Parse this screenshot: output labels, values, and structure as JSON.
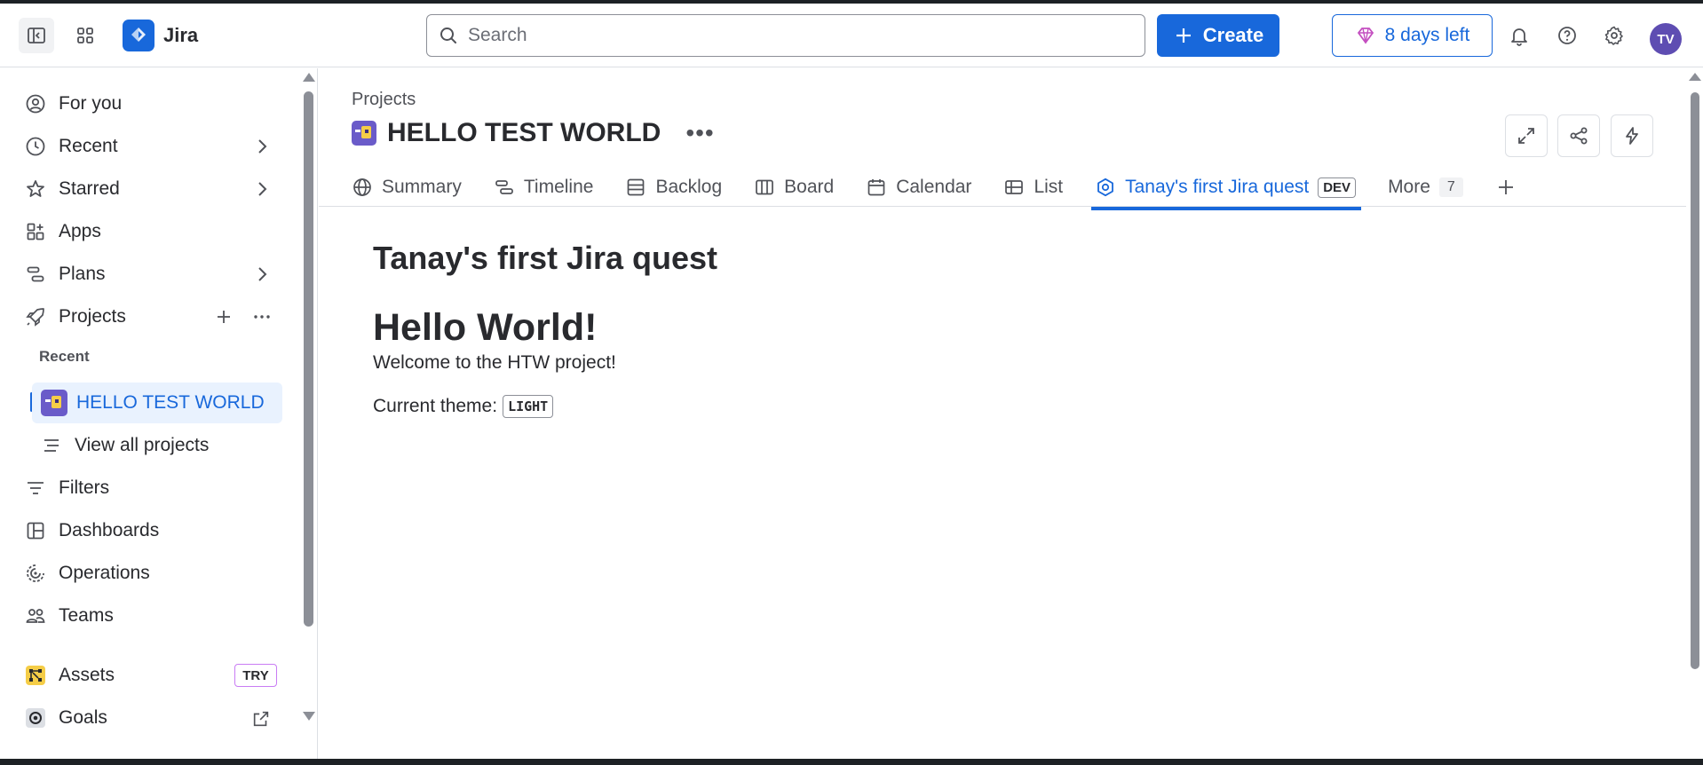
{
  "app": {
    "name": "Jira"
  },
  "topnav": {
    "search_placeholder": "Search",
    "create_label": "Create",
    "trial_label": "8 days left",
    "avatar_initials": "TV"
  },
  "sidebar": {
    "items": [
      {
        "label": "For you",
        "icon": "user-circle-icon"
      },
      {
        "label": "Recent",
        "icon": "clock-icon"
      },
      {
        "label": "Starred",
        "icon": "star-icon"
      },
      {
        "label": "Apps",
        "icon": "apps-icon"
      },
      {
        "label": "Plans",
        "icon": "plans-icon"
      },
      {
        "label": "Projects",
        "icon": "rocket-icon"
      }
    ],
    "recent_section": "Recent",
    "active_project": "HELLO TEST WORLD",
    "view_all": "View all projects",
    "lower_items": [
      {
        "label": "Filters",
        "icon": "filter-icon"
      },
      {
        "label": "Dashboards",
        "icon": "dashboard-icon"
      },
      {
        "label": "Operations",
        "icon": "operations-icon"
      },
      {
        "label": "Teams",
        "icon": "teams-icon"
      },
      {
        "label": "Assets",
        "icon": "assets-icon"
      },
      {
        "label": "Goals",
        "icon": "goals-icon"
      }
    ],
    "try_badge": "TRY"
  },
  "main": {
    "breadcrumb": "Projects",
    "project_title": "HELLO TEST WORLD",
    "tabs": [
      {
        "label": "Summary",
        "icon": "globe-icon"
      },
      {
        "label": "Timeline",
        "icon": "timeline-icon"
      },
      {
        "label": "Backlog",
        "icon": "backlog-icon"
      },
      {
        "label": "Board",
        "icon": "board-icon"
      },
      {
        "label": "Calendar",
        "icon": "calendar-icon"
      },
      {
        "label": "List",
        "icon": "list-icon"
      },
      {
        "label": "Tanay's first Jira quest",
        "icon": "app-hex-icon",
        "badge": "DEV",
        "active": true
      },
      {
        "label": "More",
        "count": "7"
      }
    ],
    "content": {
      "title": "Tanay's first Jira quest",
      "heading": "Hello World!",
      "welcome": "Welcome to the HTW project!",
      "theme_label": "Current theme:",
      "theme_value": "LIGHT"
    }
  },
  "colors": {
    "accent": "#1868db",
    "text": "#292a2e",
    "subtle": "#505258",
    "border": "#dcdfe4"
  }
}
